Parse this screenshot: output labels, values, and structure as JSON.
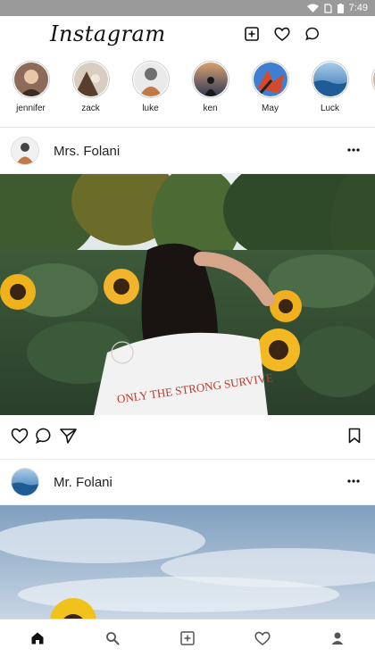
{
  "status_bar": {
    "time": "7:49"
  },
  "app": {
    "title": "Instagram"
  },
  "stories": [
    {
      "name": "jennifer",
      "color": "#6d4b3a"
    },
    {
      "name": "zack",
      "color": "#7a5c44"
    },
    {
      "name": "luke",
      "color": "#c07a48"
    },
    {
      "name": "ken",
      "color": "#3a4a66"
    },
    {
      "name": "May",
      "color": "#d4492a"
    },
    {
      "name": "Luck",
      "color": "#4a86c0"
    }
  ],
  "posts": [
    {
      "username": "Mrs. Folani",
      "image_text": "ONLY THE STRONG SURVIVE"
    },
    {
      "username": "Mr. Folani"
    }
  ],
  "icons": {
    "top": [
      "add-post-icon",
      "heart-icon",
      "chat-icon"
    ],
    "post_actions": [
      "heart-icon",
      "comment-icon",
      "send-icon",
      "bookmark-icon"
    ],
    "nav": [
      "home-icon",
      "search-icon",
      "add-icon",
      "heart-icon",
      "profile-icon"
    ]
  }
}
